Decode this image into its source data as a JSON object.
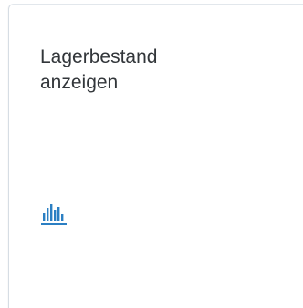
{
  "tile": {
    "title": "Lagerbestand\nanzeigen",
    "icon": "bar-chart-icon",
    "accent_color": "#2b7fc3",
    "border_color": "#d6dde4"
  }
}
